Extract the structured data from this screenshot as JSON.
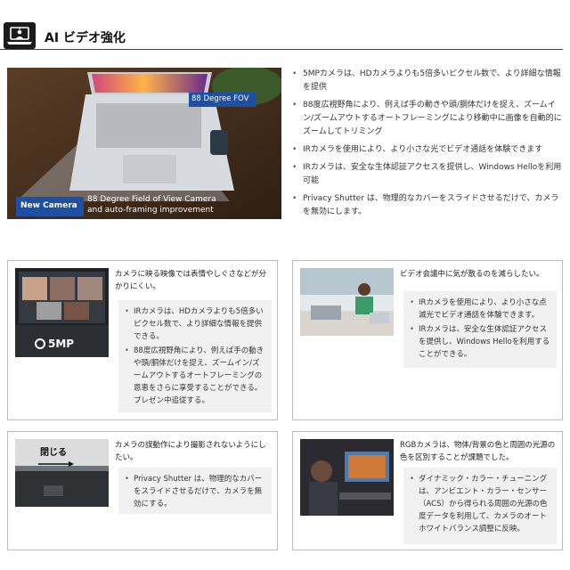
{
  "header": {
    "title": "AI ビデオ強化"
  },
  "hero": {
    "fov_badge": "88 Degree FOV",
    "camera_badge": "New Camera",
    "caption_line1": "88 Degree Field of View Camera",
    "caption_line2": "and auto-framing improvement",
    "bullets": [
      "5MPカメラは、HDカメラよりも5倍多いピクセル数で、より詳細な情報を提供",
      "88度広視野角により、例えば手の動きや頭/胴体だけを捉え、ズームイン/ズームアウトするオートフレーミングにより移動中に画像を自動的にズームしてトリミング",
      "IRカメラを使用により、より小さな光でビデオ通話を体験できます",
      "IRカメラは、安全な生体認証アクセスを提供し、Windows Helloを利用可能",
      "Privacy Shutter は、物理的なカバーをスライドさせるだけで、カメラを無効にします。"
    ]
  },
  "cards": [
    {
      "heading": "カメラに映る映像では表情やしぐさなどが分かりにくい。",
      "badge": "5MP",
      "bullets": [
        "IRカメラは、HDカメラよりも5倍多いピクセル数で、より詳細な情報を提供できる。",
        "88度広視野角により、例えば手の動きや頭/胴体だけを捉え、ズームイン/ズームアウトするオートフレーミングの恩恵をさらに享受することができる。プレゼン中追従する。"
      ]
    },
    {
      "heading": "ビデオ会議中に気が散るのを減らしたい。",
      "bullets": [
        "IRカメラを使用により、より小さな点滅光でビデオ通話を体験できます。",
        "IRカメラは、安全な生体認証アクセスを提供し、Windows Helloを利用することができる。"
      ]
    },
    {
      "heading": "カメラの誤動作により撮影されないようにしたい。",
      "close_label": "閉じる",
      "bullets": [
        "Privacy Shutter は、物理的なカバーをスライドさせるだけで、カメラを無効にする。"
      ]
    },
    {
      "heading": "RGBカメラは、物体/背景の色と周囲の光源の色を区別することが課題でした。",
      "bullets": [
        "ダイナミック・カラー・チューニングは、アンビエント・カラー・センサー（ACS）から得られる周囲の光源の色度データを利用して、カメラのオートホワイトバランス調整に反映。"
      ]
    }
  ]
}
